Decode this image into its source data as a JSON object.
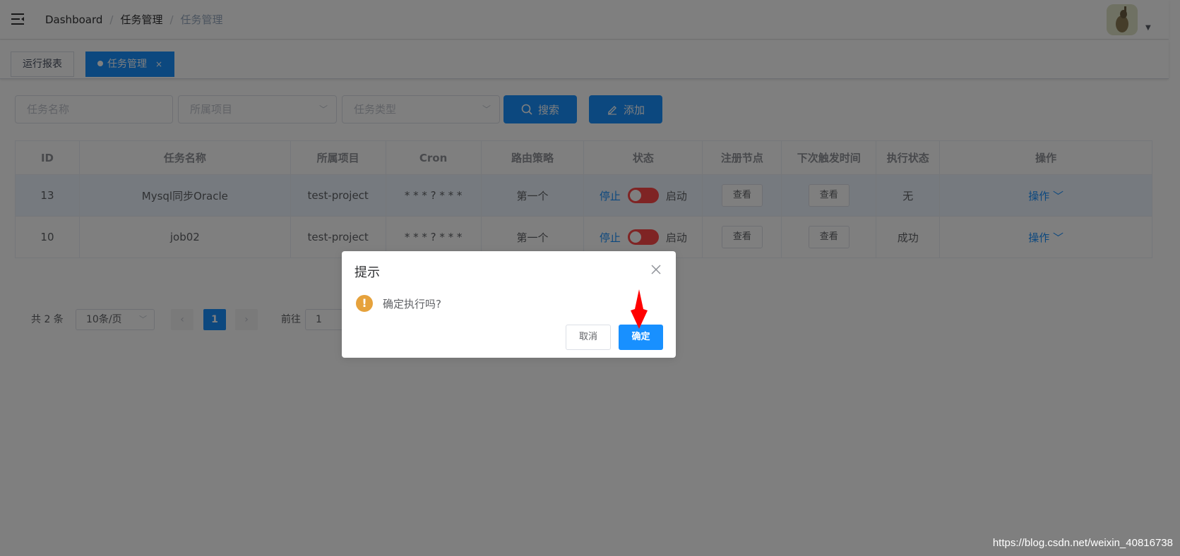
{
  "breadcrumb": [
    "Dashboard",
    "任务管理",
    "任务管理"
  ],
  "tags": [
    {
      "label": "运行报表",
      "active": false
    },
    {
      "label": "任务管理",
      "active": true,
      "close": "×"
    }
  ],
  "filters": {
    "task_name_placeholder": "任务名称",
    "project_placeholder": "所属项目",
    "task_type_placeholder": "任务类型",
    "search_label": "搜索",
    "add_label": "添加"
  },
  "table": {
    "headers": [
      "ID",
      "任务名称",
      "所属项目",
      "Cron",
      "路由策略",
      "状态",
      "注册节点",
      "下次触发时间",
      "执行状态",
      "操作"
    ],
    "rows": [
      {
        "id": "13",
        "name": "Mysql同步Oracle",
        "project": "test-project",
        "cron": "* * * ? * * *",
        "route": "第一个",
        "stop": "停止",
        "start": "启动",
        "view1": "查看",
        "view2": "查看",
        "exec_status": "无",
        "op": "操作"
      },
      {
        "id": "10",
        "name": "job02",
        "project": "test-project",
        "cron": "* * * ? * * *",
        "route": "第一个",
        "stop": "停止",
        "start": "启动",
        "view1": "查看",
        "view2": "查看",
        "exec_status": "成功",
        "op": "操作"
      }
    ]
  },
  "pagination": {
    "total": "共 2 条",
    "page_size": "10条/页",
    "current": "1",
    "goto_label": "前往",
    "goto_value": "1"
  },
  "dialog": {
    "title": "提示",
    "message": "确定执行吗?",
    "cancel": "取消",
    "confirm": "确定"
  },
  "watermark": "https://blog.csdn.net/weixin_40816738",
  "colors": {
    "primary": "#1890ff",
    "switch_off": "#ff4949",
    "warning": "#e6a23c",
    "arrow": "#ff0000"
  }
}
